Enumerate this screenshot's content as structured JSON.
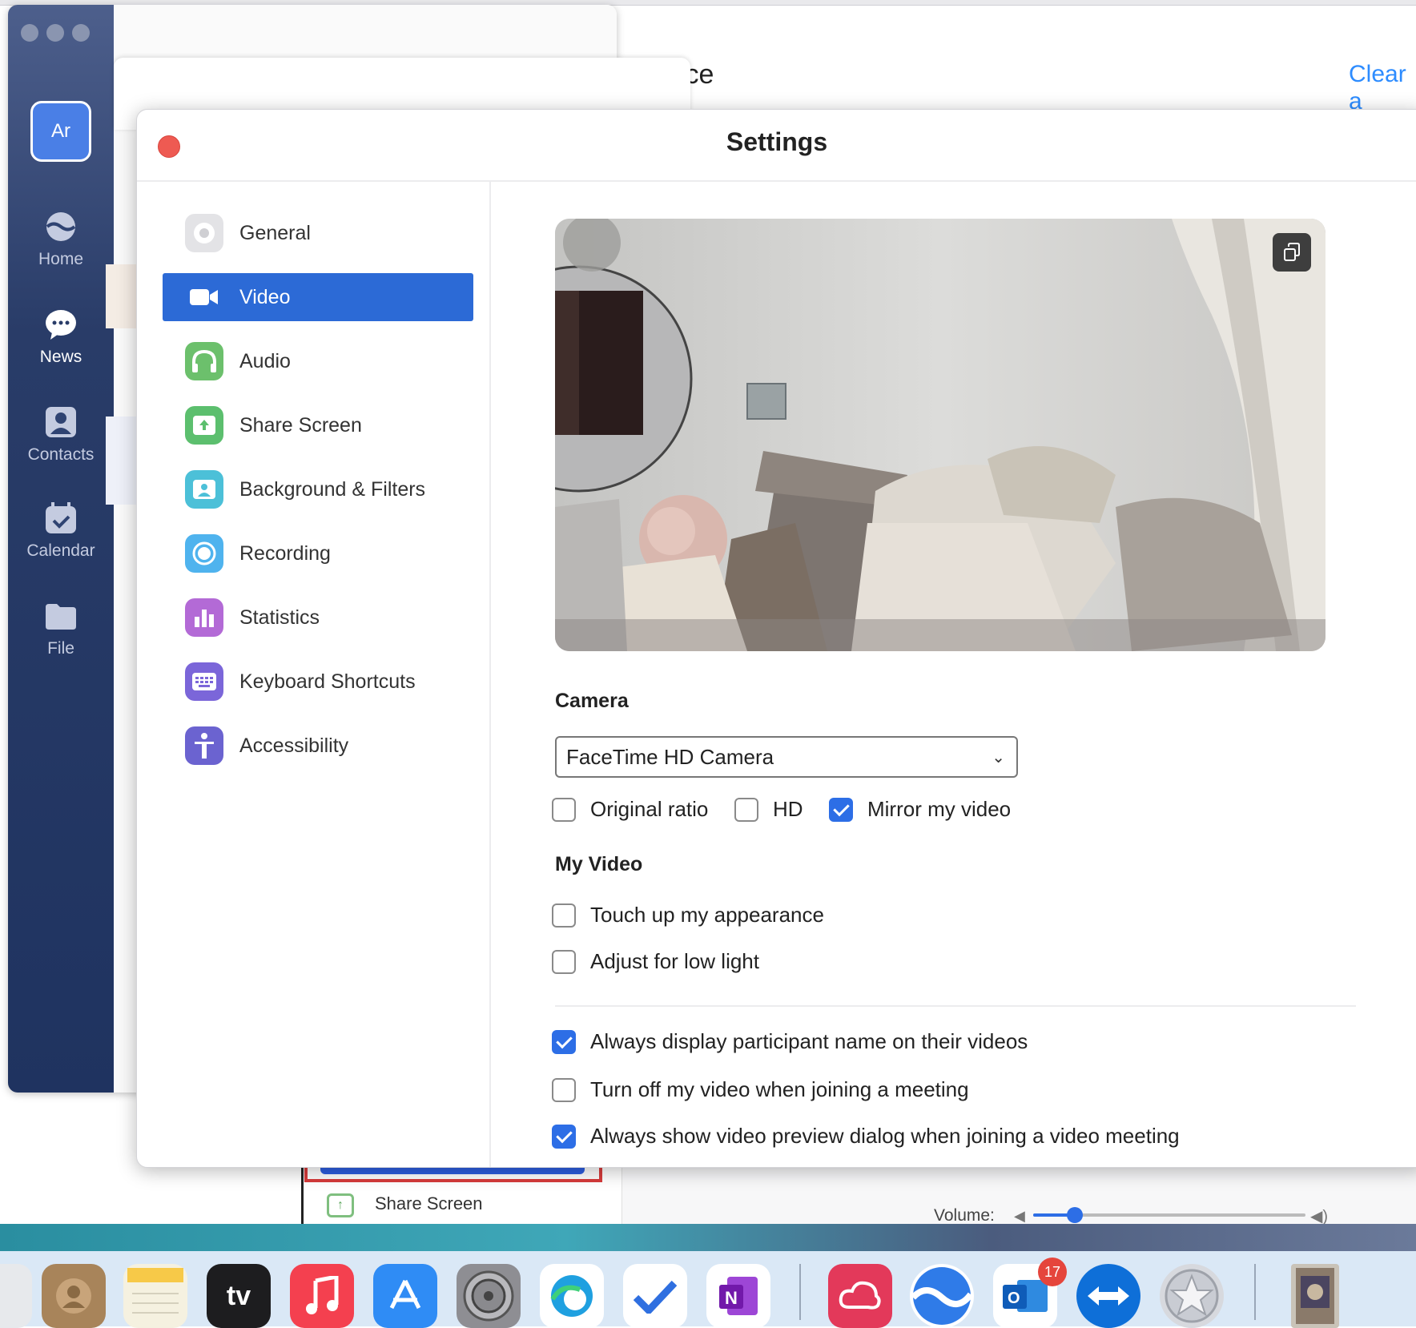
{
  "background_app": {
    "title_fragment": "ice",
    "clear_label": "Clear a"
  },
  "zoom_nav": {
    "avatar_initials": "Ar",
    "items": [
      {
        "label": "Home",
        "icon": "home-icon",
        "active": false
      },
      {
        "label": "News",
        "icon": "chat-icon",
        "active": true
      },
      {
        "label": "Contacts",
        "icon": "contacts-icon",
        "active": false
      },
      {
        "label": "Calendar",
        "icon": "calendar-icon",
        "active": false
      },
      {
        "label": "File",
        "icon": "folder-icon",
        "active": false
      }
    ]
  },
  "behind_window": {
    "share_screen_label": "Share Screen",
    "volume_label": "Volume:",
    "volume_level": 0.15
  },
  "settings": {
    "title": "Settings",
    "menu": [
      {
        "label": "General",
        "icon": "gear-icon",
        "color": "#d9d9dc"
      },
      {
        "label": "Video",
        "icon": "video-camera-icon",
        "color": "#2c6ad6"
      },
      {
        "label": "Audio",
        "icon": "headphones-icon",
        "color": "#6cc06c"
      },
      {
        "label": "Share Screen",
        "icon": "share-screen-icon",
        "color": "#5cbf6e"
      },
      {
        "label": "Background & Filters",
        "icon": "person-frame-icon",
        "color": "#4cc0d8"
      },
      {
        "label": "Recording",
        "icon": "record-icon",
        "color": "#4fb3ee"
      },
      {
        "label": "Statistics",
        "icon": "bar-chart-icon",
        "color": "#b36ad6"
      },
      {
        "label": "Keyboard Shortcuts",
        "icon": "keyboard-icon",
        "color": "#7b66d9"
      },
      {
        "label": "Accessibility",
        "icon": "accessibility-icon",
        "color": "#6b63d0"
      }
    ],
    "active_menu": "Video",
    "camera_heading": "Camera",
    "camera_selected": "FaceTime HD Camera",
    "camera_options": [
      {
        "label": "Original ratio",
        "checked": false
      },
      {
        "label": "HD",
        "checked": false
      },
      {
        "label": "Mirror my video",
        "checked": true
      }
    ],
    "my_video_heading": "My Video",
    "my_video_options": [
      {
        "label": "Touch up my appearance",
        "checked": false
      },
      {
        "label": "Adjust for low light",
        "checked": false
      }
    ],
    "meeting_options": [
      {
        "label": "Always display participant name on their videos",
        "checked": true
      },
      {
        "label": "Turn off my video when joining a meeting",
        "checked": false
      },
      {
        "label": "Always show video preview dialog when joining a video meeting",
        "checked": true
      }
    ]
  },
  "dock": {
    "outlook_badge": "17",
    "apple_tv_label": "tv",
    "apps": [
      {
        "name": "contacts-app-icon",
        "color": "#a8845a"
      },
      {
        "name": "notes-app-icon",
        "color": "#f5f1e0"
      },
      {
        "name": "apple-tv-app-icon",
        "color": "#1d1d1f"
      },
      {
        "name": "music-app-icon",
        "color": "#f4404f"
      },
      {
        "name": "app-store-app-icon",
        "color": "#2f8cf5"
      },
      {
        "name": "system-preferences-app-icon",
        "color": "#8e8e93"
      },
      {
        "name": "edge-app-icon",
        "color": "#ffffff"
      },
      {
        "name": "todo-app-icon",
        "color": "#ffffff"
      },
      {
        "name": "onenote-app-icon",
        "color": "#ffffff"
      },
      {
        "name": "creative-cloud-app-icon",
        "color": "#e3395a"
      },
      {
        "name": "zoom-launcher-app-icon",
        "color": "#ffffff"
      },
      {
        "name": "outlook-app-icon",
        "color": "#ffffff"
      },
      {
        "name": "teamviewer-app-icon",
        "color": "#0e6fd8"
      },
      {
        "name": "launchpad-app-icon",
        "color": "#d7d9de"
      },
      {
        "name": "preview-thumbnail-app-icon",
        "color": "#c9c3b8"
      }
    ]
  }
}
